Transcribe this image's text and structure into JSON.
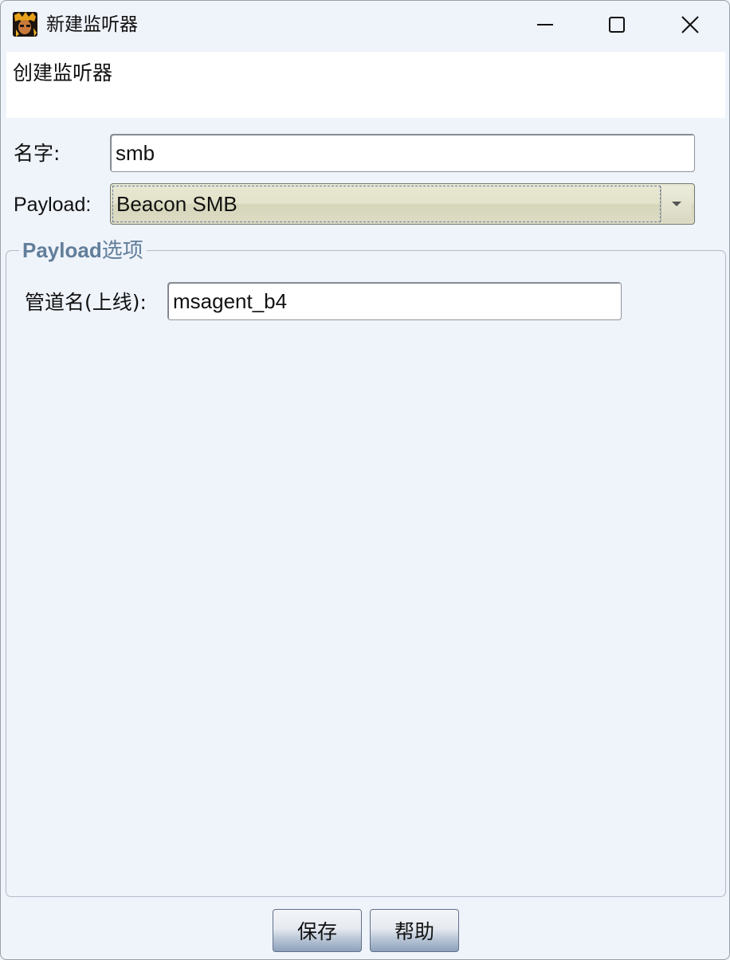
{
  "window": {
    "title": "新建监听器",
    "minimize_icon": "minimize-icon",
    "maximize_icon": "maximize-icon",
    "close_icon": "close-icon"
  },
  "header": {
    "text": "创建监听器"
  },
  "form": {
    "name_label": "名字:",
    "name_value": "smb",
    "payload_label": "Payload:",
    "payload_value": "Beacon SMB"
  },
  "payload_options": {
    "group_title_latin": "Payload",
    "group_title_cjk": "选项",
    "pipe_label": "管道名(上线):",
    "pipe_value": "msagent_b4"
  },
  "buttons": {
    "save": "保存",
    "help": "帮助"
  },
  "colors": {
    "background": "#eff3fa",
    "group_title": "#617e9a",
    "combo_fill": "#e3e3cb"
  }
}
